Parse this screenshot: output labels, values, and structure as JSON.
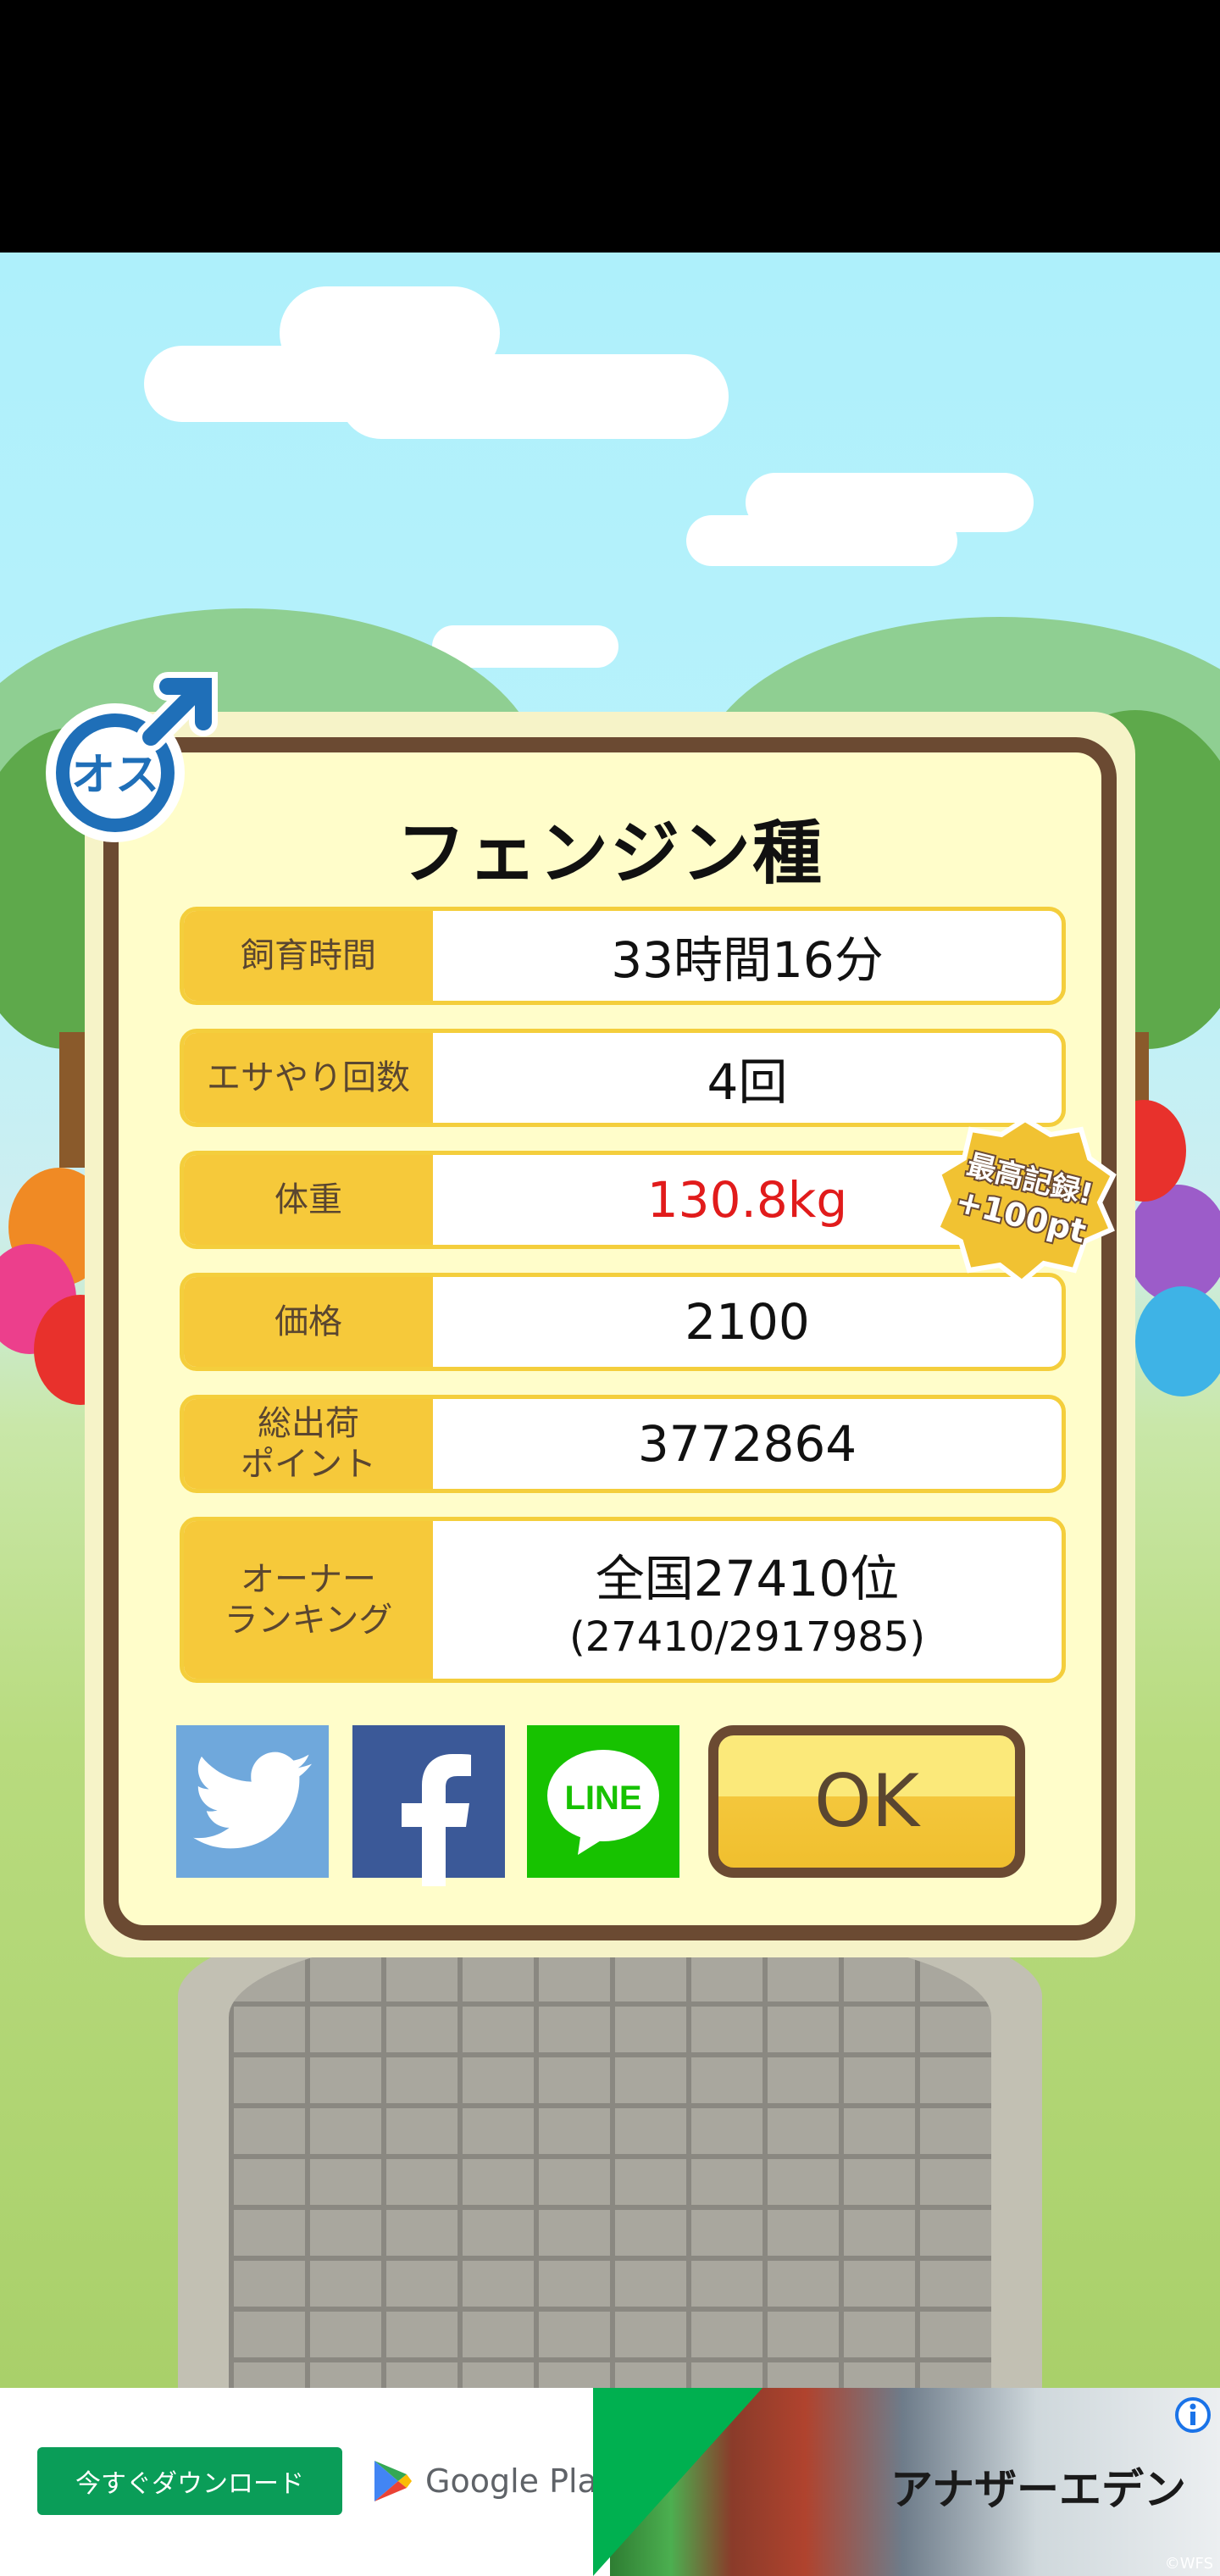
{
  "dialog": {
    "title": "フェンジン種",
    "rows": [
      {
        "label": "飼育時間",
        "value": "33時間16分"
      },
      {
        "label": "エサやり回数",
        "value": "4回"
      },
      {
        "label": "体重",
        "value": "130.8kg"
      },
      {
        "label": "価格",
        "value": "2100"
      },
      {
        "label": "総出荷\nポイント",
        "value": "3772864"
      },
      {
        "label": "オーナー\nランキング",
        "value": "全国27410位",
        "sub": "(27410/2917985)"
      }
    ],
    "ok_label": "OK",
    "gender_badge": "オス",
    "record_badge_line1": "最高記録!",
    "record_badge_line2": "+100pt",
    "line_label": "LINE",
    "colors": {
      "highlight_value": "#e11b1b",
      "frame": "#6b4a32",
      "label_bg": "#f6c93a"
    }
  },
  "ad": {
    "download_label": "今すぐダウンロード",
    "store_label": "Google Play",
    "game_title": "アナザーエデン",
    "copyright": "©WFS"
  }
}
